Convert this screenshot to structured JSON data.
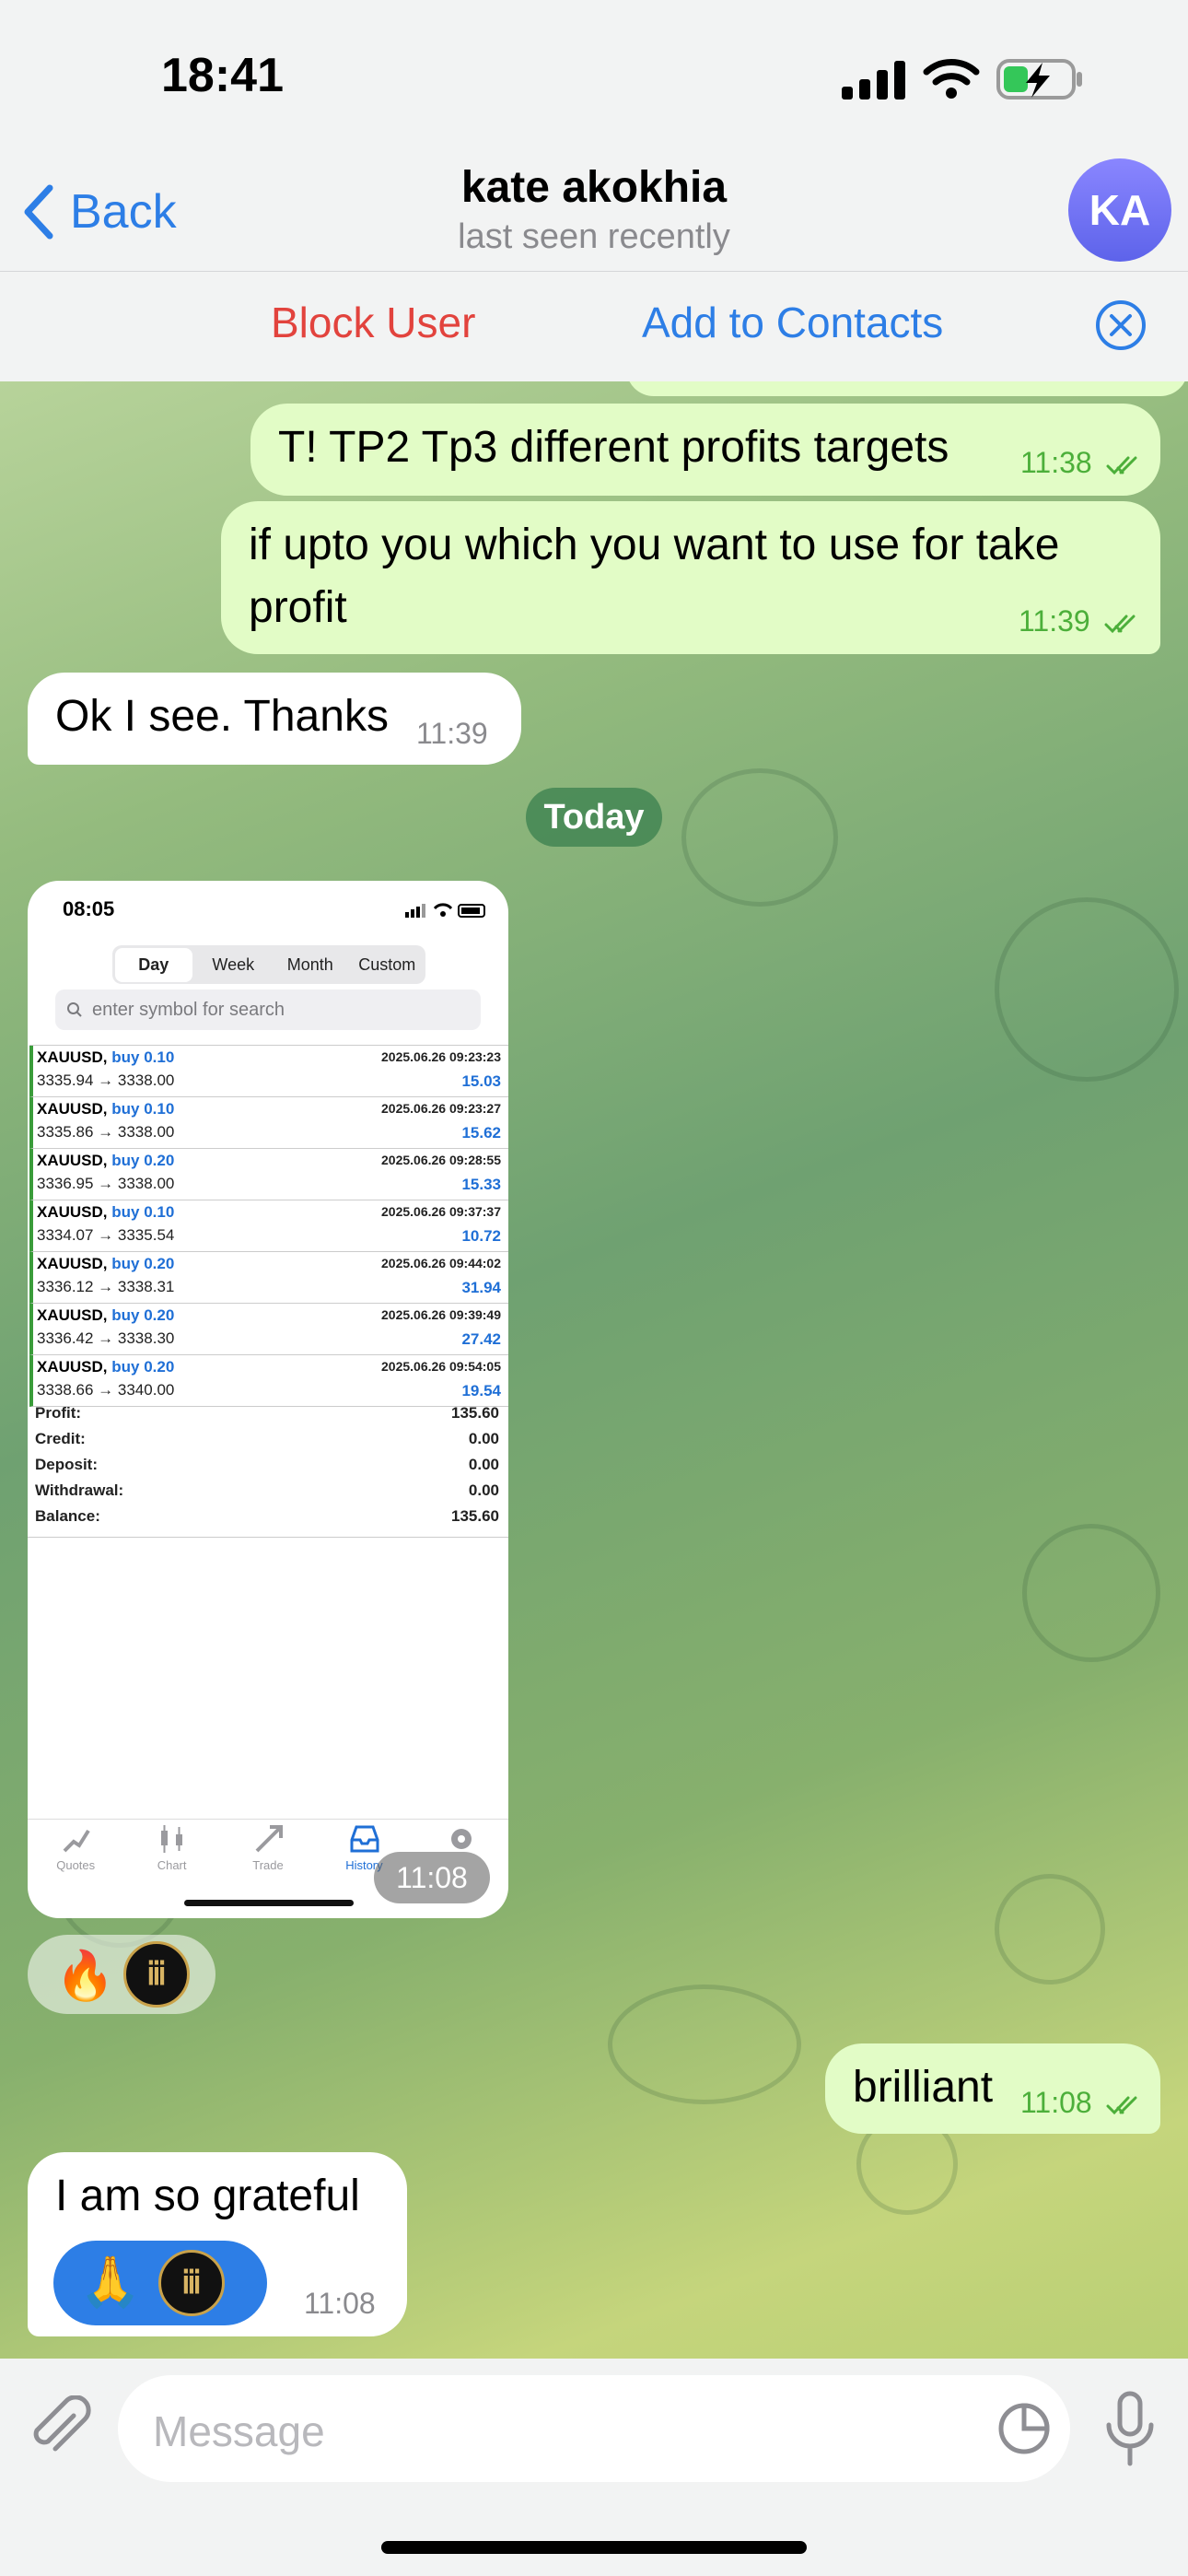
{
  "status_bar": {
    "time": "18:41"
  },
  "header": {
    "back_label": "Back",
    "title": "kate akokhia",
    "subtitle": "last seen recently",
    "avatar_initials": "KA"
  },
  "action_bar": {
    "block_label": "Block User",
    "add_contact_label": "Add to Contacts"
  },
  "messages": {
    "m1": {
      "text": "T! TP2 Tp3 different profits targets",
      "time": "11:38"
    },
    "m2": {
      "text": "if upto you which you want to use for take profit",
      "time": "11:39"
    },
    "m3": {
      "text": "Ok I see. Thanks",
      "time": "11:39"
    },
    "date_separator": "Today",
    "m4": {
      "time": "11:08"
    },
    "m5": {
      "emoji": "🔥"
    },
    "m6": {
      "text": "brilliant",
      "time": "11:08"
    },
    "m7": {
      "text": "I am so grateful",
      "emoji": "🙏",
      "time": "11:08"
    }
  },
  "screenshot": {
    "time": "08:05",
    "periods": [
      "Day",
      "Week",
      "Month",
      "Custom"
    ],
    "search_placeholder": "enter symbol for search",
    "trades": [
      {
        "symbol": "XAUUSD,",
        "side": "buy 0.10",
        "prices": "3335.94 → 3338.00",
        "datetime": "2025.06.26 09:23:23",
        "profit": "15.03"
      },
      {
        "symbol": "XAUUSD,",
        "side": "buy 0.10",
        "prices": "3335.86 → 3338.00",
        "datetime": "2025.06.26 09:23:27",
        "profit": "15.62"
      },
      {
        "symbol": "XAUUSD,",
        "side": "buy 0.20",
        "prices": "3336.95 → 3338.00",
        "datetime": "2025.06.26 09:28:55",
        "profit": "15.33"
      },
      {
        "symbol": "XAUUSD,",
        "side": "buy 0.10",
        "prices": "3334.07 → 3335.54",
        "datetime": "2025.06.26 09:37:37",
        "profit": "10.72"
      },
      {
        "symbol": "XAUUSD,",
        "side": "buy 0.20",
        "prices": "3336.12 → 3338.31",
        "datetime": "2025.06.26 09:44:02",
        "profit": "31.94"
      },
      {
        "symbol": "XAUUSD,",
        "side": "buy 0.20",
        "prices": "3336.42 → 3338.30",
        "datetime": "2025.06.26 09:39:49",
        "profit": "27.42"
      },
      {
        "symbol": "XAUUSD,",
        "side": "buy 0.20",
        "prices": "3338.66 → 3340.00",
        "datetime": "2025.06.26 09:54:05",
        "profit": "19.54"
      }
    ],
    "summary": [
      {
        "label": "Profit:",
        "value": "135.60"
      },
      {
        "label": "Credit:",
        "value": "0.00"
      },
      {
        "label": "Deposit:",
        "value": "0.00"
      },
      {
        "label": "Withdrawal:",
        "value": "0.00"
      },
      {
        "label": "Balance:",
        "value": "135.60"
      }
    ],
    "tabs": [
      "Quotes",
      "Chart",
      "Trade",
      "History"
    ]
  },
  "composer": {
    "placeholder": "Message"
  },
  "colors": {
    "accent_blue": "#2d7ee6",
    "danger_red": "#e2433d",
    "outgoing_bubble": "#e2fcc6",
    "read_check_green": "#4caf3a"
  }
}
